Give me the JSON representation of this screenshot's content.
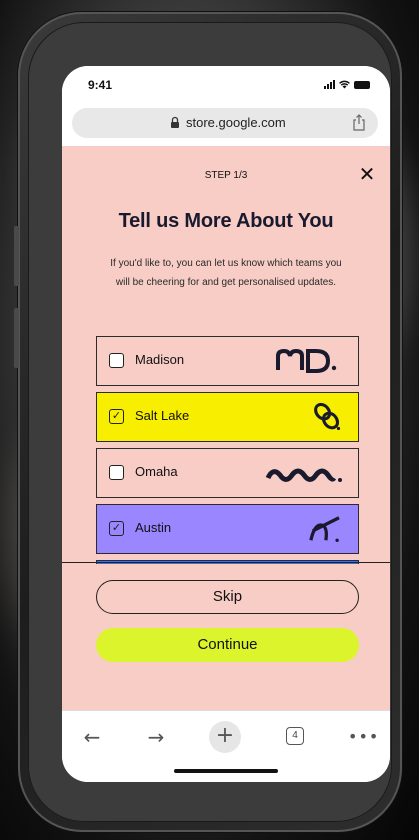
{
  "status_bar": {
    "time": "9:41"
  },
  "browser": {
    "url": "store.google.com",
    "tab_count": "4"
  },
  "modal": {
    "step": "STEP 1/3",
    "close_label": "✕",
    "title": "Tell us More About You",
    "description": "If you'd like to, you can let us know which teams you will be cheering for and get personalised updates."
  },
  "teams": [
    {
      "name": "Madison",
      "selected": false,
      "color": "#f7cdc6",
      "logo": "madison-logo-icon"
    },
    {
      "name": "Salt Lake",
      "selected": true,
      "color": "#f8ef00",
      "logo": "salt-lake-logo-icon"
    },
    {
      "name": "Omaha",
      "selected": false,
      "color": "#f7cdc6",
      "logo": "omaha-logo-icon"
    },
    {
      "name": "Austin",
      "selected": true,
      "color": "#9a86ff",
      "logo": "austin-logo-icon"
    },
    {
      "name": "",
      "selected": false,
      "color": "#3d6ef0",
      "logo": "partial-logo-icon"
    }
  ],
  "actions": {
    "skip_label": "Skip",
    "continue_label": "Continue"
  },
  "toolbar": {
    "back_icon": "←",
    "forward_icon": "→",
    "new_tab_icon": "+",
    "more_icon": "•••"
  },
  "colors": {
    "background": "#f7cdc6",
    "accent": "#dcf42c",
    "text": "#1a1a2e"
  }
}
